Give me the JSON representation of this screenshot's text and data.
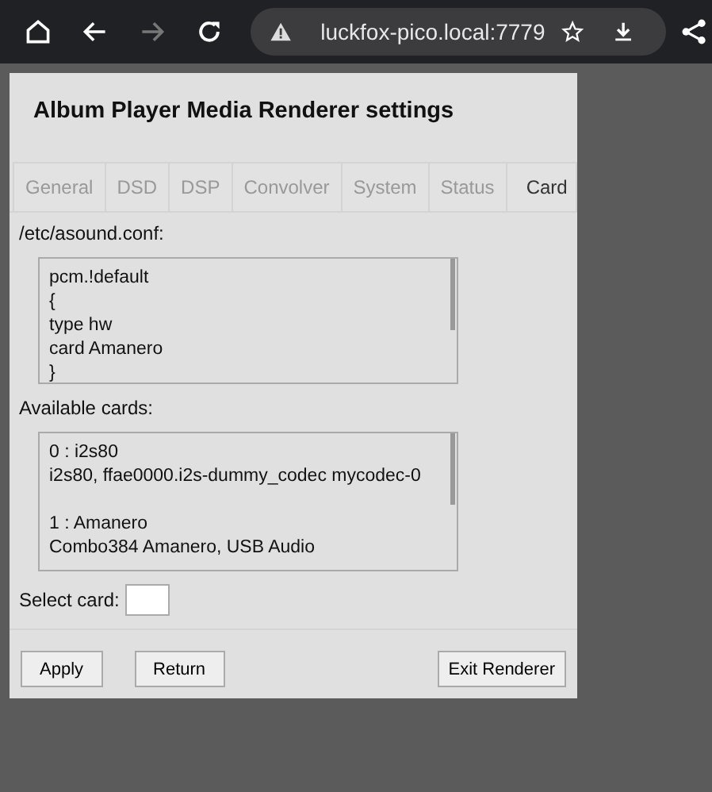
{
  "browser": {
    "url": "luckfox-pico.local:7779",
    "forward_disabled": true
  },
  "title": "Album Player Media Renderer settings",
  "tabs": [
    {
      "label": "General",
      "selected": false
    },
    {
      "label": "DSD",
      "selected": false
    },
    {
      "label": "DSP",
      "selected": false
    },
    {
      "label": "Convolver",
      "selected": false
    },
    {
      "label": "System",
      "selected": false
    },
    {
      "label": "Status",
      "selected": false
    },
    {
      "label": "Card",
      "selected": true
    }
  ],
  "config": {
    "label": "/etc/asound.conf:",
    "lines": [
      "pcm.!default",
      "{",
      "type hw",
      "card Amanero",
      "}"
    ]
  },
  "cards": {
    "label": "Available cards:",
    "entries": [
      {
        "name": "0 : i2s80",
        "detail": "i2s80, ffae0000.i2s-dummy_codec mycodec-0"
      },
      {
        "name": "1 : Amanero",
        "detail": "Combo384 Amanero, USB Audio"
      }
    ]
  },
  "select_card": {
    "label": "Select card:"
  },
  "buttons": [
    "Apply",
    "Return",
    "Exit Renderer"
  ]
}
